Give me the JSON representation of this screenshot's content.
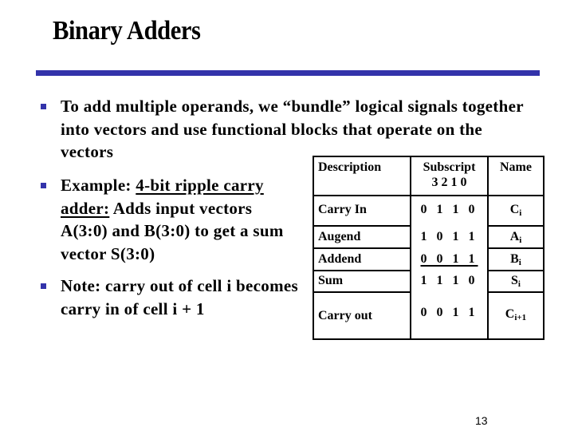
{
  "slide": {
    "title": "Binary Adders",
    "accent_color": "#3333aa",
    "page_number": "13"
  },
  "bullets": [
    {
      "text": "To  add multiple operands, we “bundle” logical signals together into vectors and use functional blocks that operate on the vectors"
    },
    {
      "prefix": "Example: ",
      "underlined": "4-bit ripple carry adder:",
      "rest": "  Adds input vectors A(3:0) and B(3:0) to get a sum  vector S(3:0)"
    },
    {
      "text": "Note: carry out of cell i becomes carry in of cell i + 1"
    }
  ],
  "table": {
    "headers": {
      "description": "Description",
      "subscript": "Subscript",
      "subscript_indices": "3 2 1 0",
      "name": "Name"
    },
    "rows": [
      {
        "description": "Carry In",
        "bits": "0 1 1 0",
        "name": "C",
        "name_sub": "i"
      },
      {
        "description": "Augend",
        "bits": "1 0 1 1",
        "name": "A",
        "name_sub": "i"
      },
      {
        "description": "Addend",
        "bits": "0 0 1 1",
        "name": "B",
        "name_sub": "i",
        "underlined": true
      },
      {
        "description": "Sum",
        "bits": "1 1 1 0",
        "name": "S",
        "name_sub": "i"
      },
      {
        "description": "Carry out",
        "bits": "0 0 1 1",
        "name": "C",
        "name_sub": "i+1"
      }
    ]
  }
}
